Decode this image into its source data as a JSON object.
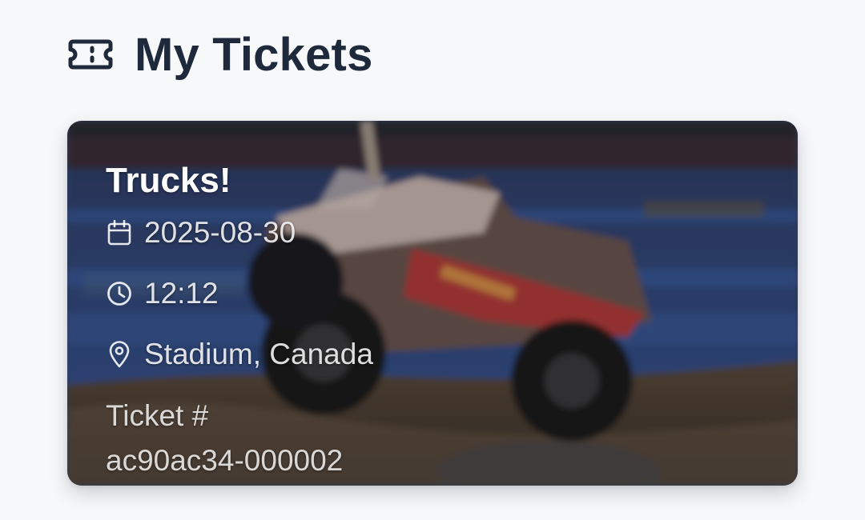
{
  "header": {
    "title": "My Tickets",
    "icon": "ticket-icon"
  },
  "tickets": [
    {
      "event_name": "Trucks!",
      "date": "2025-08-30",
      "time": "12:12",
      "location": "Stadium, Canada",
      "ticket_label": "Ticket #",
      "ticket_number": "ac90ac34-000002",
      "image_subject": "monster truck jumping in stadium arena",
      "icons": {
        "date": "calendar-icon",
        "time": "clock-icon",
        "location": "map-pin-icon"
      }
    }
  ],
  "colors": {
    "background": "#f7f8fa",
    "title_text": "#1e293b",
    "card_text": "#ffffff"
  }
}
